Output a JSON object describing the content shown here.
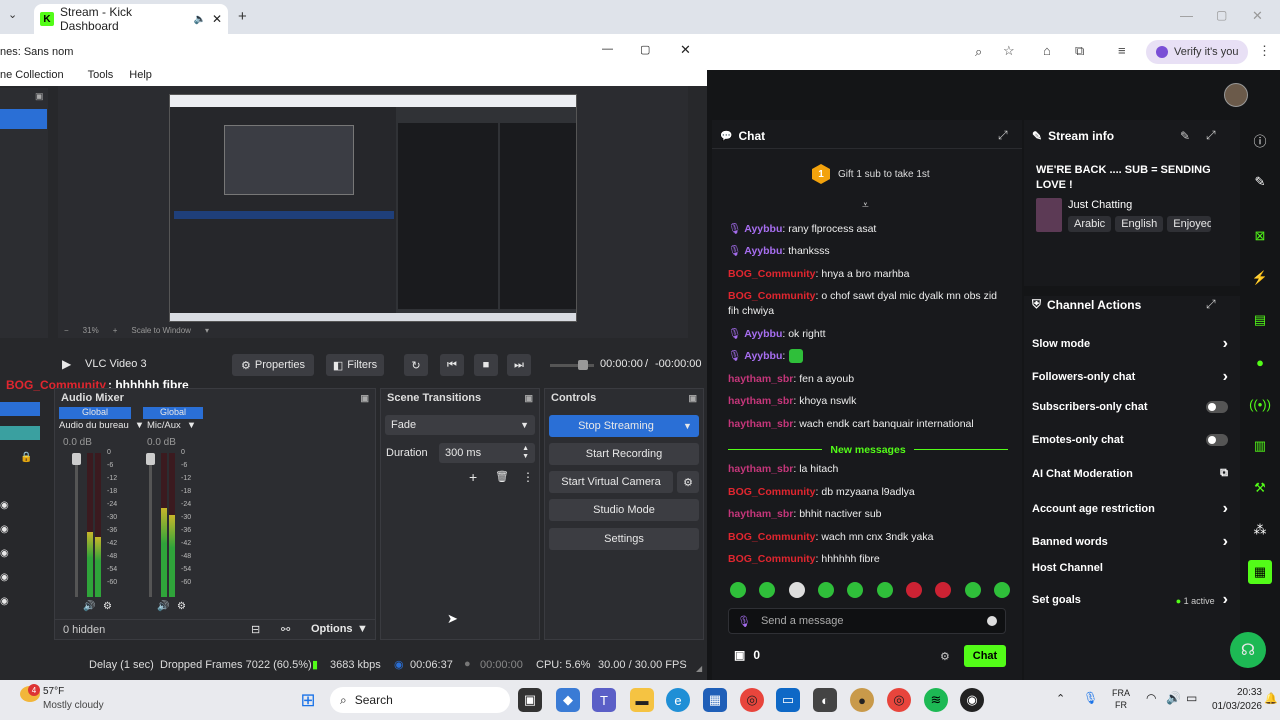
{
  "browser": {
    "tab_title": "Stream - Kick Dashboard",
    "verify_label": "Verify it's you"
  },
  "obs": {
    "window_title": "nes: Sans nom",
    "menu": [
      "ne Collection",
      "Tools",
      "Help"
    ],
    "zoom": "31%",
    "zoom_mode": "Scale to Window",
    "overlay_user": "BOG_Community",
    "overlay_msg": ": hhhhhh fibre",
    "source_name": "VLC Video 3",
    "properties": "Properties",
    "filters": "Filters",
    "time_current": "00:00:00",
    "time_sep": "/",
    "time_total": "-00:00:00",
    "audio_mixer": {
      "title": "Audio Mixer",
      "channels": [
        {
          "scope": "Global",
          "name": "Audio du bureau",
          "db": "0.0 dB",
          "level": 0.45
        },
        {
          "scope": "Global",
          "name": "Mic/Aux",
          "db": "0.0 dB",
          "level": 0.62
        }
      ],
      "scale": [
        "0",
        "-6",
        "-12",
        "-18",
        "-24",
        "-30",
        "-36",
        "-42",
        "-48",
        "-54",
        "-60"
      ],
      "hidden": "0 hidden",
      "options": "Options"
    },
    "transitions": {
      "title": "Scene Transitions",
      "selected": "Fade",
      "duration_label": "Duration",
      "duration_value": "300 ms"
    },
    "controls": {
      "title": "Controls",
      "stop_streaming": "Stop Streaming",
      "start_recording": "Start Recording",
      "start_virtual_camera": "Start Virtual Camera",
      "studio_mode": "Studio Mode",
      "settings": "Settings"
    },
    "status": {
      "delay": "Delay (1 sec)",
      "dropped": "Dropped Frames 7022 (60.5%)",
      "bitrate": "3683 kbps",
      "stream_time": "00:06:37",
      "rec_time": "00:00:00",
      "cpu": "CPU: 5.6%",
      "fps": "30.00 / 30.00 FPS"
    }
  },
  "kick": {
    "chat_title": "Chat",
    "gift_text": "Gift 1 sub to take 1st",
    "gift_rank": "1",
    "messages": [
      {
        "user": "Ayybbu",
        "text": ": rany flprocess asat",
        "color": "purple",
        "badge": true
      },
      {
        "user": "Ayybbu",
        "text": ": thanksss",
        "color": "purple",
        "badge": true
      },
      {
        "user": "BOG_Community",
        "text": ": hnya a bro marhba",
        "color": "red",
        "badge": false
      },
      {
        "user": "BOG_Community",
        "text": ": o chof sawt dyal mic dyalk mn obs zid fih chwiya",
        "color": "red",
        "badge": false
      },
      {
        "user": "Ayybbu",
        "text": ": ok rightt",
        "color": "purple",
        "badge": true
      },
      {
        "user": "Ayybbu",
        "text": ":",
        "color": "purple",
        "badge": true
      },
      {
        "user": "haytham_sbr",
        "text": ": fen a ayoub",
        "color": "green",
        "badge": false
      },
      {
        "user": "haytham_sbr",
        "text": ": khoya nswlk",
        "color": "green",
        "badge": false
      },
      {
        "user": "haytham_sbr",
        "text": ": wach endk cart banquair international",
        "color": "green",
        "badge": false
      }
    ],
    "new_messages": "New messages",
    "new": [
      {
        "user": "haytham_sbr",
        "text": ": la hitach",
        "color": "green"
      },
      {
        "user": "BOG_Community",
        "text": ": db mzyaana l9adlya",
        "color": "red"
      },
      {
        "user": "haytham_sbr",
        "text": ": bhhit nactiver sub",
        "color": "green"
      },
      {
        "user": "BOG_Community",
        "text": ": wach mn cnx 3ndk yaka",
        "color": "red"
      },
      {
        "user": "BOG_Community",
        "text": ": hhhhhh fibre",
        "color": "red"
      }
    ],
    "send_placeholder": "Send a message",
    "points": "0",
    "chat_button": "Chat",
    "stream_info": {
      "title": "Stream info",
      "stream_title": "WE'RE BACK .... SUB = SENDING LOVE !",
      "category": "Just Chatting",
      "tags": [
        "Arabic",
        "English",
        "Enjoyed"
      ]
    },
    "channel_actions": {
      "title": "Channel Actions",
      "items": [
        {
          "label": "Slow mode",
          "ctrl": "arrow"
        },
        {
          "label": "Followers-only chat",
          "ctrl": "arrow"
        },
        {
          "label": "Subscribers-only chat",
          "ctrl": "toggle"
        },
        {
          "label": "Emotes-only chat",
          "ctrl": "toggle"
        },
        {
          "label": "AI Chat Moderation",
          "ctrl": "ext"
        },
        {
          "label": "Account age restriction",
          "ctrl": "arrow"
        },
        {
          "label": "Banned words",
          "ctrl": "arrow"
        },
        {
          "label": "Host Channel",
          "ctrl": "none"
        },
        {
          "label": "Set goals",
          "ctrl": "arrow"
        }
      ],
      "goals_active": "1 active"
    }
  },
  "taskbar": {
    "temp": "57°F",
    "weather": "Mostly cloudy",
    "weather_badge": "4",
    "search": "Search",
    "lang1": "FRA",
    "lang2": "FR",
    "time": "20:33",
    "date": "01/03/2026"
  },
  "colors": {
    "kick_green": "#53fc18",
    "obs_blue": "#2a6fd6"
  }
}
